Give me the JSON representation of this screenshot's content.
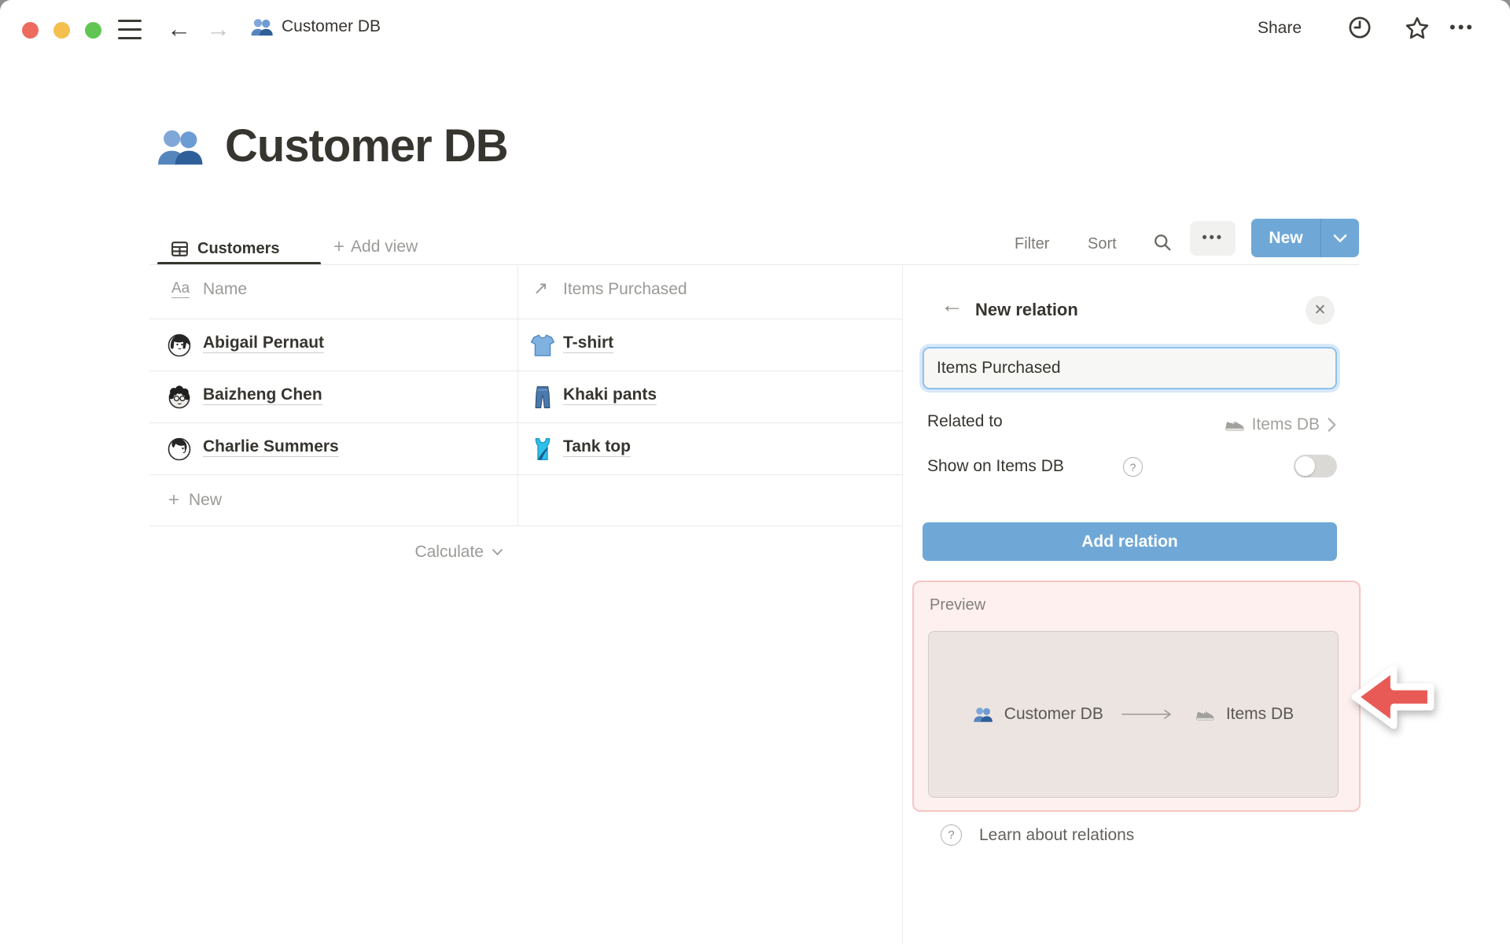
{
  "window": {
    "doc_title": "Customer DB",
    "share_label": "Share",
    "ellipsis": "•••"
  },
  "page": {
    "title": "Customer DB"
  },
  "toolbar": {
    "view_tab": "Customers",
    "add_view": "Add view",
    "filter": "Filter",
    "sort": "Sort",
    "new_button": "New"
  },
  "table": {
    "header": {
      "name_type_icon": "Aa",
      "name": "Name",
      "relation_arrow": "↗",
      "items": "Items Purchased"
    },
    "rows": [
      {
        "name": "Abigail Pernaut",
        "item": "T-shirt"
      },
      {
        "name": "Baizheng Chen",
        "item": "Khaki pants"
      },
      {
        "name": "Charlie Summers",
        "item": "Tank top"
      }
    ],
    "new_row": "New",
    "calculate": "Calculate"
  },
  "panel": {
    "title": "New relation",
    "close": "✕",
    "back_arrow": "←",
    "name_input_value": "Items Purchased",
    "related_to_label": "Related to",
    "related_to_value": "Items DB",
    "show_on_label": "Show on Items DB",
    "show_on_enabled": false,
    "add_button": "Add relation",
    "preview_label": "Preview",
    "preview_source": "Customer DB",
    "preview_target": "Items DB",
    "learn_link": "Learn about relations",
    "help_glyph": "?"
  },
  "colors": {
    "accent_blue": "#6fa8d7",
    "text_dark": "#37352f",
    "text_gray": "#9b9a97",
    "preview_bg": "#fdf0ee",
    "preview_border": "#f6c6c4",
    "annotation_red": "#e85a56",
    "traffic_red": "#ec6a5e",
    "traffic_yellow": "#f4bf4f",
    "traffic_green": "#61c554"
  }
}
